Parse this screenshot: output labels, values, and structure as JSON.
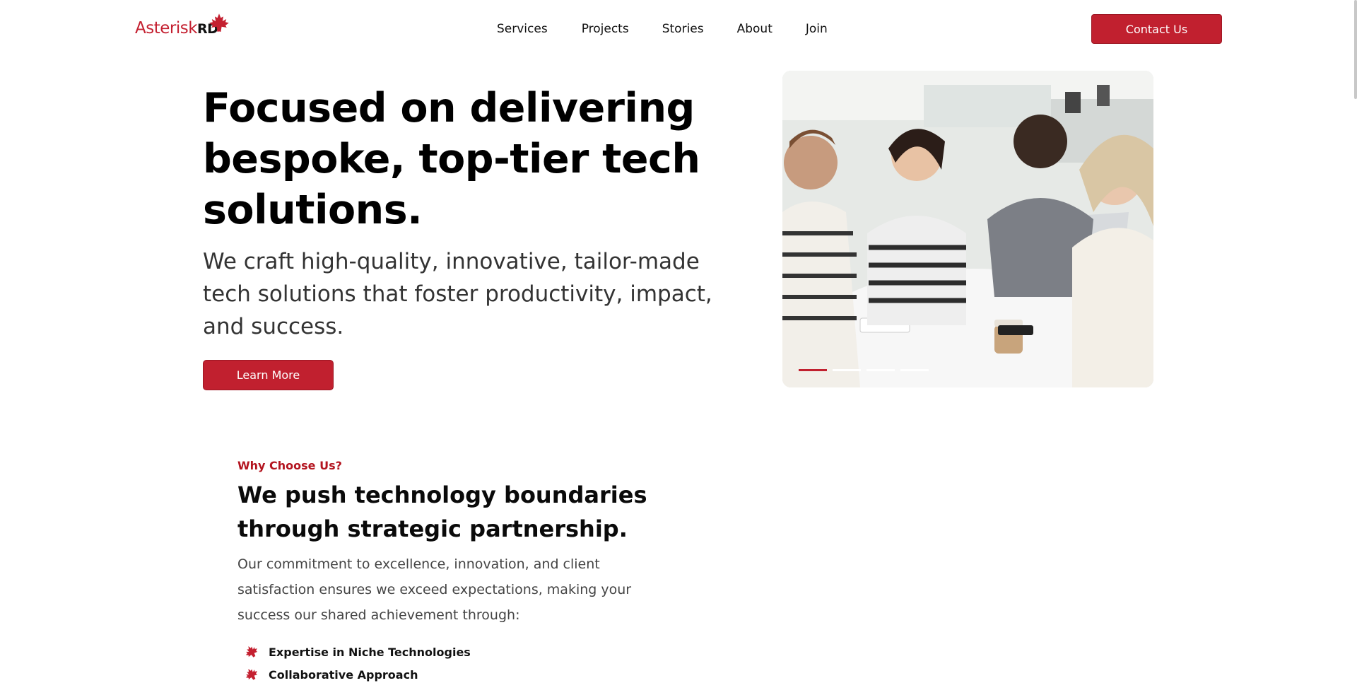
{
  "header": {
    "logo": {
      "part1": "Asterisk",
      "part2": "RD"
    },
    "nav": [
      "Services",
      "Projects",
      "Stories",
      "About",
      "Join"
    ],
    "contact_label": "Contact Us"
  },
  "hero": {
    "title": "Focused on delivering bespoke, top-tier tech solutions.",
    "subtitle": "We craft high-quality, innovative, tailor-made tech solutions that foster productivity, impact, and success.",
    "cta_label": "Learn More",
    "carousel": {
      "slides": 4,
      "active": 1
    }
  },
  "why": {
    "label": "Why Choose Us?",
    "title": "We push technology boundaries through strategic partnership.",
    "text": "Our commitment to excellence, innovation, and client satisfaction ensures we exceed expectations, making your success our shared achievement through:",
    "items": [
      "Expertise in Niche Technologies",
      "Collaborative Approach"
    ]
  },
  "colors": {
    "accent": "#c1202f",
    "label": "#b3141f"
  },
  "icons": {
    "logo_mark": "maple-leaf-icon",
    "bullet": "maple-leaf-icon"
  }
}
